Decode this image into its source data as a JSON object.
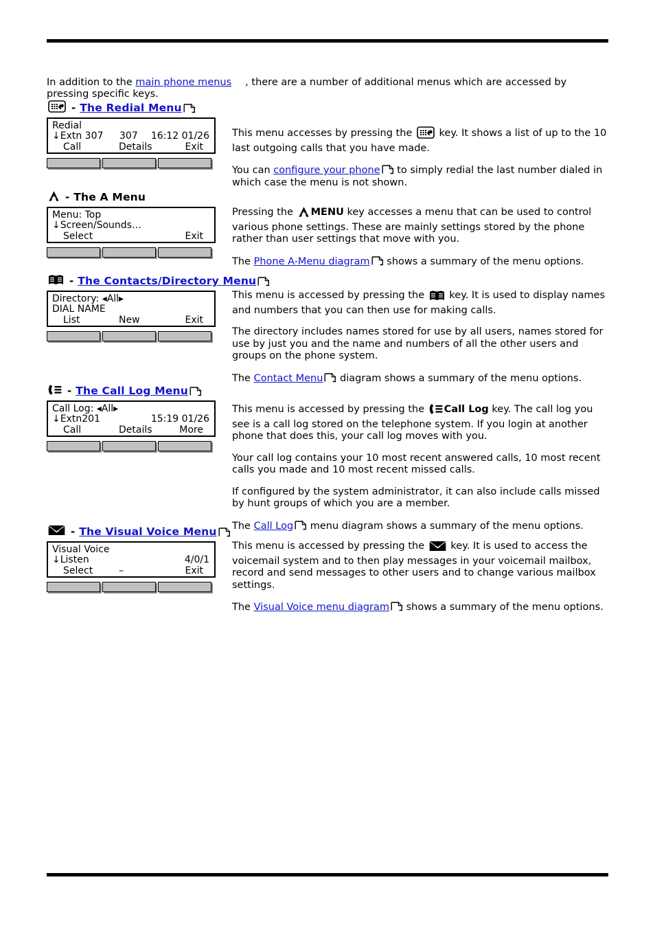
{
  "intro": {
    "before": "In addition to the ",
    "link": "main phone menus",
    "after": ", there are a number of additional menus which are accessed by pressing specific keys."
  },
  "sections": [
    {
      "id": "redial",
      "icon": "redial-icon",
      "dash": "-",
      "title": "The Redial Menu",
      "title_is_link": true,
      "has_page_glyph": true,
      "display": {
        "line1": "Redial",
        "line2_left": "↓Extn 307",
        "line2_mid": "307",
        "line2_right": "16:12 01/26",
        "softkey1": "Call",
        "softkey2": "Details",
        "softkey3": "Exit"
      },
      "paragraphs": [
        {
          "parts": [
            {
              "t": "text",
              "v": "This menu accesses by pressing the "
            },
            {
              "t": "icon",
              "v": "redial-icon"
            },
            {
              "t": "text",
              "v": " key. It shows a list of up to the 10 last outgoing calls that you have made."
            }
          ]
        },
        {
          "parts": [
            {
              "t": "text",
              "v": "You can "
            },
            {
              "t": "link",
              "v": "configure your phone"
            },
            {
              "t": "glyph",
              "v": "page-link-icon"
            },
            {
              "t": "text",
              "v": " to simply redial the last number dialed in which case the menu is not shown."
            }
          ]
        }
      ]
    },
    {
      "id": "amenu",
      "icon": "a-menu-icon",
      "dash": "-",
      "title": "The A Menu",
      "title_is_link": false,
      "has_page_glyph": false,
      "display": {
        "line1": "Menu: Top",
        "line2_left": "↓Screen/Sounds…",
        "line2_mid": "",
        "line2_right": "",
        "softkey1": "Select",
        "softkey2": "",
        "softkey3": "Exit"
      },
      "paragraphs": [
        {
          "parts": [
            {
              "t": "text",
              "v": "Pressing the "
            },
            {
              "t": "icon",
              "v": "a-menu-icon"
            },
            {
              "t": "bold",
              "v": "MENU"
            },
            {
              "t": "text",
              "v": " key accesses a menu that can be used to control various phone settings. These are mainly settings stored by the phone rather than user settings that move with you."
            }
          ]
        },
        {
          "parts": [
            {
              "t": "text",
              "v": "The "
            },
            {
              "t": "link",
              "v": "Phone A-Menu diagram"
            },
            {
              "t": "glyph",
              "v": "page-link-icon"
            },
            {
              "t": "text",
              "v": " shows a summary of the menu options."
            }
          ]
        }
      ]
    },
    {
      "id": "contacts",
      "icon": "contacts-book-icon",
      "dash": "-",
      "title": "The Contacts/Directory Menu",
      "title_is_link": true,
      "has_page_glyph": true,
      "display": {
        "line1": "Directory: ◂All▸",
        "line2_left": "DIAL NAME",
        "line2_mid": "",
        "line2_right": "",
        "softkey1": "List",
        "softkey2": "New",
        "softkey3": "Exit"
      },
      "paragraphs": [
        {
          "parts": [
            {
              "t": "text",
              "v": "This menu is accessed by pressing the "
            },
            {
              "t": "icon",
              "v": "contacts-book-icon"
            },
            {
              "t": "text",
              "v": " key. It is used to display names and numbers that you can then use for making calls."
            }
          ]
        },
        {
          "parts": [
            {
              "t": "text",
              "v": "The directory includes names stored for use by all users, names stored for use by just you and the name and numbers of all the other users and groups on the phone system."
            }
          ]
        },
        {
          "parts": [
            {
              "t": "text",
              "v": "The "
            },
            {
              "t": "link",
              "v": "Contact Menu"
            },
            {
              "t": "glyph",
              "v": "page-link-icon"
            },
            {
              "t": "text",
              "v": " diagram shows a summary of the menu options."
            }
          ]
        }
      ]
    },
    {
      "id": "calllog",
      "icon": "call-log-icon",
      "dash": "-",
      "title": "The Call Log Menu",
      "title_is_link": true,
      "has_page_glyph": true,
      "display": {
        "line1": "Call Log: ◂All▸",
        "line2_left": "↓Extn201",
        "line2_mid": "",
        "line2_right": "15:19 01/26",
        "softkey1": "Call",
        "softkey2": "Details",
        "softkey3": "More"
      },
      "paragraphs": [
        {
          "parts": [
            {
              "t": "text",
              "v": "This menu is accessed by pressing the "
            },
            {
              "t": "icon",
              "v": "call-log-icon"
            },
            {
              "t": "bold",
              "v": "Call Log"
            },
            {
              "t": "text",
              "v": " key. The call log you see is a call log stored on the telephone system. If you login at another phone that does this, your call log moves with you."
            }
          ]
        },
        {
          "parts": [
            {
              "t": "text",
              "v": "Your call log contains your 10 most recent answered calls, 10 most recent calls you made and 10 most recent missed calls."
            }
          ]
        },
        {
          "parts": [
            {
              "t": "text",
              "v": "If configured by the system administrator, it can also include calls missed by hunt groups of which you are a member."
            }
          ]
        },
        {
          "parts": [
            {
              "t": "text",
              "v": "The "
            },
            {
              "t": "link",
              "v": "Call Log"
            },
            {
              "t": "glyph",
              "v": "page-link-icon"
            },
            {
              "t": "text",
              "v": " menu diagram shows a summary of the menu options."
            }
          ]
        }
      ]
    },
    {
      "id": "voice",
      "icon": "visual-voice-icon",
      "dash": "-",
      "title": "The Visual Voice Menu",
      "title_is_link": true,
      "has_page_glyph": true,
      "display": {
        "line1": "Visual Voice",
        "line2_left": "↓Listen",
        "line2_mid": "",
        "line2_right": "4/0/1",
        "softkey1": "Select",
        "softkey2": "–",
        "softkey3": "Exit"
      },
      "paragraphs": [
        {
          "parts": [
            {
              "t": "text",
              "v": "This menu is accessed by pressing the "
            },
            {
              "t": "icon",
              "v": "visual-voice-icon"
            },
            {
              "t": "text",
              "v": " key. It is used to access the voicemail system and to then play messages in your voicemail mailbox, record and send messages to other users and to change various mailbox settings."
            }
          ]
        },
        {
          "parts": [
            {
              "t": "text",
              "v": "The "
            },
            {
              "t": "link",
              "v": "Visual Voice menu diagram"
            },
            {
              "t": "glyph",
              "v": "page-link-icon"
            },
            {
              "t": "text",
              "v": " shows a summary of the menu options."
            }
          ]
        }
      ]
    }
  ],
  "colors": {
    "link": "#1414cc",
    "rule": "#000000",
    "softkey_fill": "#c0c0c0"
  }
}
